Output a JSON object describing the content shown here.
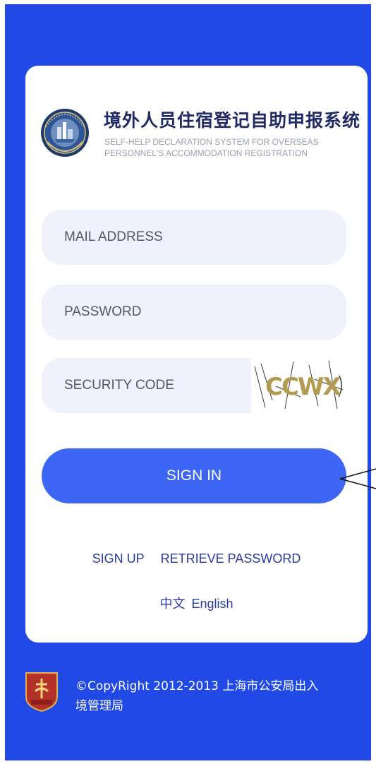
{
  "header": {
    "title_cn": "境外人员住宿登记自助申报系统",
    "title_en": "SELF-HELP DECLARATION SYSTEM FOR OVERSEAS PERSONNEL'S ACCOMMODATION REGISTRATION",
    "logo_icon": "police-emblem-icon"
  },
  "form": {
    "email_placeholder": "MAIL ADDRESS",
    "password_placeholder": "PASSWORD",
    "security_placeholder": "SECURITY CODE",
    "captcha_text": "CCWX",
    "signin_label": "SIGN IN"
  },
  "links": {
    "signup": "SIGN UP",
    "retrieve": "RETRIEVE PASSWORD"
  },
  "language": {
    "chinese": "中文",
    "english": "English"
  },
  "footer": {
    "copyright": "©CopyRight 2012-2013 上海市公安局出入境管理局",
    "badge_icon": "immigration-badge-icon"
  },
  "colors": {
    "background": "#2149e6",
    "button": "#3c66f3",
    "field": "#eff2fd",
    "title": "#1f2a66",
    "link": "#2a3a9e"
  }
}
